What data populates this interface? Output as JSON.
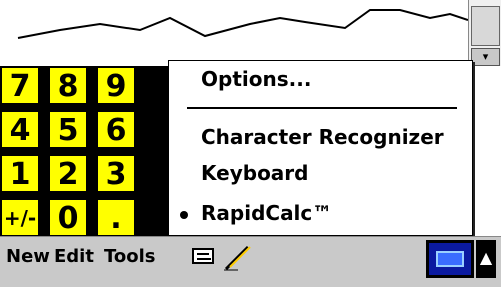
{
  "popup_menu": {
    "items": [
      {
        "label": "Options..."
      },
      {
        "label": "Character Recognizer"
      },
      {
        "label": "Keyboard"
      },
      {
        "label": "RapidCalc™",
        "selected": true
      }
    ]
  },
  "keypad": {
    "keys": [
      "7",
      "8",
      "9",
      "4",
      "5",
      "6",
      "1",
      "2",
      "3",
      "+/-",
      "0",
      "."
    ]
  },
  "menubar": {
    "new_label": "New",
    "edit_label": "Edit",
    "tools_label": "Tools"
  },
  "icons": {
    "keyboard": "keyboard-icon",
    "pen": "pen-icon",
    "input_panel": "input-panel-icon",
    "up_arrow": "up-arrow-icon",
    "scroll_down": "down-arrow-icon"
  },
  "colors": {
    "keypad_key": "#ffff00",
    "menubar": "#c9c9c9",
    "input_panel": "#0b1aa0"
  }
}
